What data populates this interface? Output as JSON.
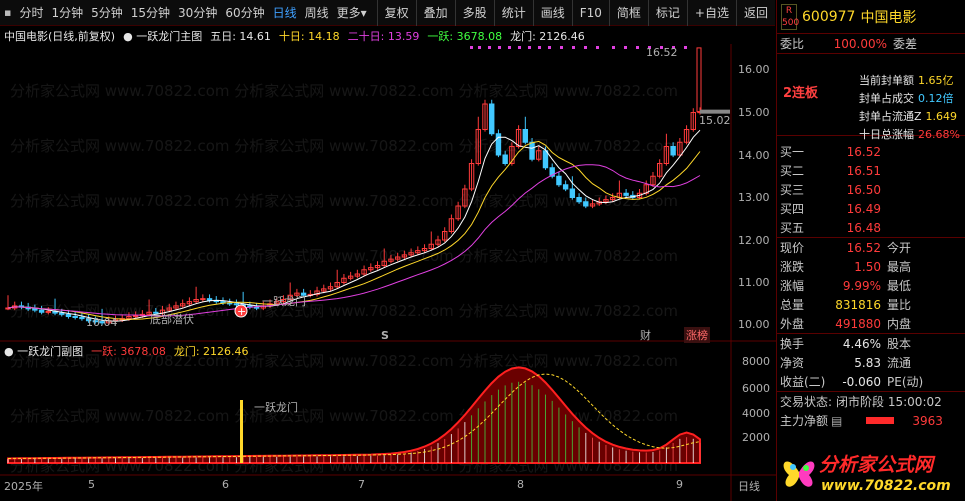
{
  "toolbar": {
    "left": [
      "分时",
      "1分钟",
      "5分钟",
      "15分钟",
      "30分钟",
      "60分钟",
      "日线",
      "周线",
      "更多"
    ],
    "active": "日线",
    "more_caret": "▾",
    "right": [
      "复权",
      "叠加",
      "多股",
      "统计",
      "画线",
      "F10",
      "简框",
      "标记",
      "+自选",
      "返回"
    ]
  },
  "main_info": {
    "stock": "中国电影",
    "period": "(日线,前复权)",
    "indicator": "一跃龙门主图",
    "ma5_label": "五日:",
    "ma5": "14.61",
    "ma10_label": "十日:",
    "ma10": "14.18",
    "ma20_label": "二十日:",
    "ma20": "13.59",
    "yiyue_label": "一跃:",
    "yiyue": "3678.08",
    "longmen_label": "龙门:",
    "longmen": "2126.46"
  },
  "y_axis": [
    "16.00",
    "15.00",
    "14.00",
    "13.00",
    "12.00",
    "11.00",
    "10.00"
  ],
  "sub_axis": [
    "8000",
    "6000",
    "4000",
    "2000"
  ],
  "x_axis": [
    "2025年",
    "5",
    "6",
    "7",
    "8",
    "9",
    "日线"
  ],
  "annotations": {
    "high": "16.52",
    "low": "10.04",
    "last": "15.02",
    "s_marker": "S",
    "cai": "财",
    "zhangbang": "涨榜",
    "chuji": "底部潜伏",
    "yuelongmen": "一跃龙门",
    "plus": "+"
  },
  "sub_info": {
    "indicator": "一跃龙门副图",
    "yiyue_label": "一跃:",
    "yiyue": "3678.08",
    "longmen_label": "龙门:",
    "longmen": "2126.46",
    "marker": "一跃龙门"
  },
  "quote": {
    "badge_top": "R",
    "badge_bottom": "500",
    "code": "600977",
    "name": "中国电影",
    "weibi_label": "委比",
    "weibi": "100.00%",
    "weicha_label": "委差",
    "lianban": "2连板",
    "seal": [
      {
        "label": "当前封单额",
        "value": "1.65亿"
      },
      {
        "label": "封单占成交",
        "value": "0.12倍"
      },
      {
        "label": "封单占流通Z",
        "value": "1.649"
      },
      {
        "label": "十日总涨幅",
        "value": "26.68%"
      }
    ],
    "buy": [
      {
        "label": "买一",
        "price": "16.52"
      },
      {
        "label": "买二",
        "price": "16.51"
      },
      {
        "label": "买三",
        "price": "16.50"
      },
      {
        "label": "买四",
        "price": "16.49"
      },
      {
        "label": "买五",
        "price": "16.48"
      }
    ],
    "stats": [
      {
        "label": "现价",
        "value": "16.52",
        "label2": "今开"
      },
      {
        "label": "涨跌",
        "value": "1.50",
        "label2": "最高"
      },
      {
        "label": "涨幅",
        "value": "9.99%",
        "label2": "最低"
      },
      {
        "label": "总量",
        "value": "831816",
        "label2": "量比"
      },
      {
        "label": "外盘",
        "value": "491880",
        "label2": "内盘"
      }
    ],
    "stats2": [
      {
        "label": "换手",
        "value": "4.46%",
        "label2": "股本"
      },
      {
        "label": "净资",
        "value": "5.83",
        "label2": "流通"
      },
      {
        "label": "收益(二)",
        "value": "-0.060",
        "label2": "PE(动)"
      }
    ],
    "trade_status_label": "交易状态:",
    "trade_status": "闭市阶段 15:00:02",
    "main_net_label": "主力净额",
    "main_net": "3963",
    "logo_text": "分析家公式网",
    "logo_url": "www.70822.com"
  },
  "colors": {
    "up": "#ff3b3b",
    "down": "#41c8ff",
    "ma5": "#ffffff",
    "ma10": "#ffd82a",
    "ma20": "#e040e0"
  }
}
